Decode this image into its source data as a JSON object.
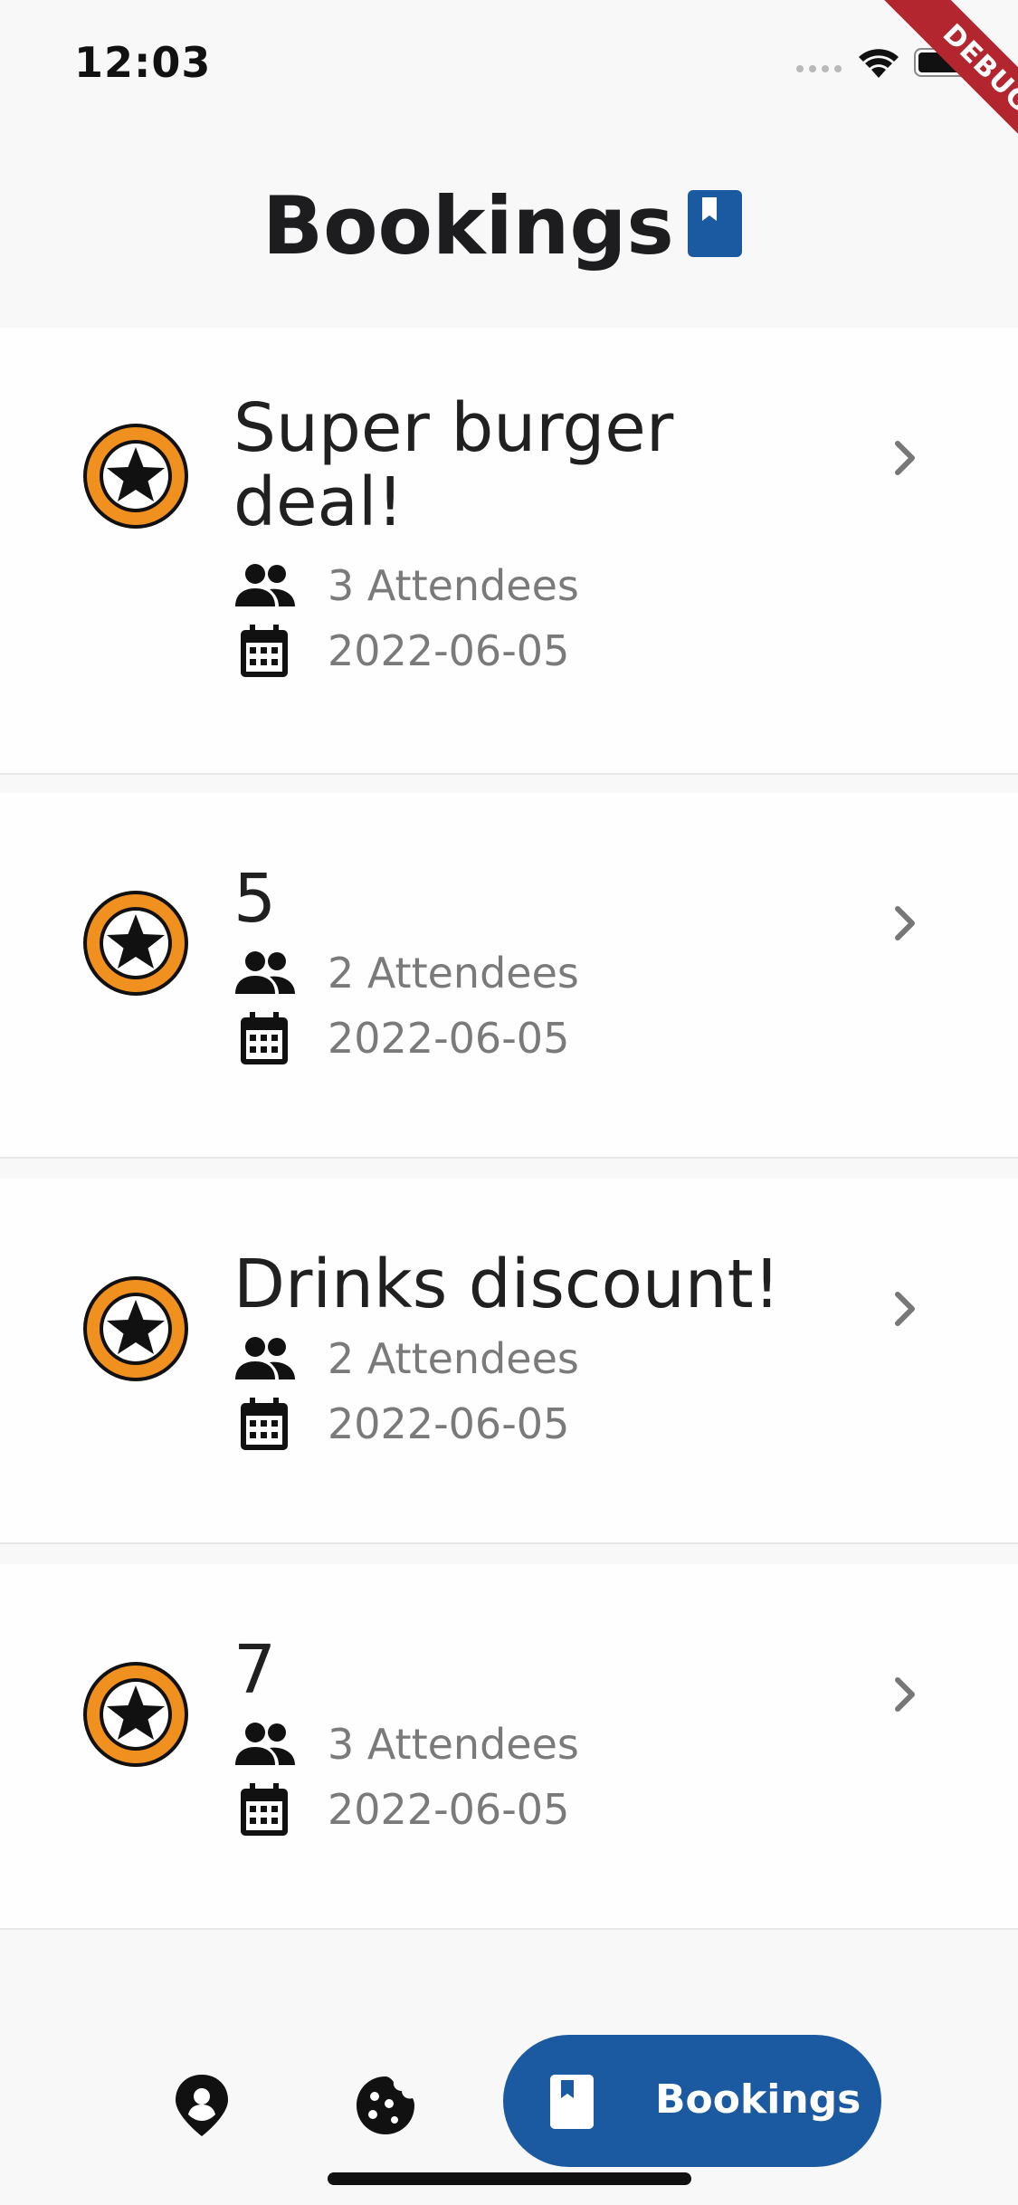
{
  "status_bar": {
    "time": "12:03",
    "debug_label": "DEBUG"
  },
  "header": {
    "title": "Bookings",
    "icon": "bookmark-book-icon",
    "accent": "#1b5aa0"
  },
  "bookings": [
    {
      "title": "Super burger deal!",
      "attendees": "3 Attendees",
      "date": "2022-06-05"
    },
    {
      "title": "5",
      "attendees": "2 Attendees",
      "date": "2022-06-05"
    },
    {
      "title": "Drinks discount!",
      "attendees": "2 Attendees",
      "date": "2022-06-05"
    },
    {
      "title": "7",
      "attendees": "3 Attendees",
      "date": "2022-06-05"
    }
  ],
  "icons": {
    "avatar": "star-badge-icon",
    "attendees": "people-icon",
    "date": "calendar-icon",
    "open": "chevron-right-icon"
  },
  "colors": {
    "badge_orange": "#f0901e",
    "nav_active": "#1b5aa0"
  },
  "bottom_nav": {
    "items": [
      {
        "icon": "location-pin-icon"
      },
      {
        "icon": "cookie-icon"
      },
      {
        "icon": "bookmark-book-icon",
        "label": "Bookings",
        "active": true
      }
    ]
  }
}
